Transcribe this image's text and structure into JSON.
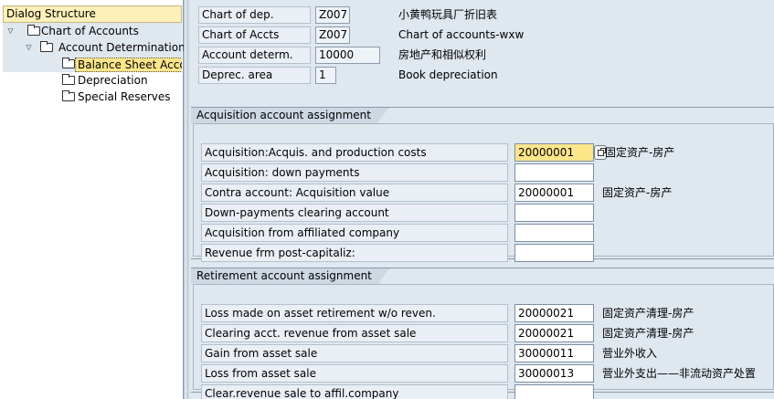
{
  "dialog_structure": {
    "title": "Dialog Structure",
    "nodes": [
      {
        "label": "Chart of Accounts",
        "level": 0,
        "expanded": true
      },
      {
        "label": "Account Determination",
        "level": 1,
        "expanded": true
      },
      {
        "label": "Balance Sheet Accou",
        "level": 2,
        "selected": true
      },
      {
        "label": "Depreciation",
        "level": 2
      },
      {
        "label": "Special Reserves",
        "level": 2
      }
    ]
  },
  "header_fields": [
    {
      "label": "Chart of dep.",
      "value": "Z007",
      "description": "小黄鸭玩具厂折旧表"
    },
    {
      "label": "Chart of Accts",
      "value": "Z007",
      "description": "Chart of accounts-wxw"
    },
    {
      "label": "Account determ.",
      "value": "10000",
      "description": "房地产和相似权利"
    },
    {
      "label": "Deprec. area",
      "value": "1",
      "description": "Book depreciation"
    }
  ],
  "acquisition_group": {
    "title": "Acquisition account assignment",
    "rows": [
      {
        "label": "Acquisition:Acquis. and production costs",
        "value": "20000001",
        "description": "固定资产-房产"
      },
      {
        "label": "Acquisition: down payments",
        "value": "",
        "description": ""
      },
      {
        "label": "Contra account: Acquisition value",
        "value": "20000001",
        "description": "固定资产-房产"
      },
      {
        "label": "Down-payments clearing account",
        "value": "",
        "description": ""
      },
      {
        "label": "Acquisition from affiliated company",
        "value": "",
        "description": ""
      },
      {
        "label": "Revenue frm post-capitaliz:",
        "value": "",
        "description": ""
      }
    ]
  },
  "retirement_group": {
    "title": "Retirement account assignment",
    "rows": [
      {
        "label": "Loss made on asset retirement w/o reven.",
        "value": "20000021",
        "description": "固定资产清理-房产"
      },
      {
        "label": "Clearing acct. revenue from asset sale",
        "value": "20000021",
        "description": "固定资产清理-房产"
      },
      {
        "label": "Gain from asset sale",
        "value": "30000011",
        "description": "营业外收入"
      },
      {
        "label": "Loss from asset sale",
        "value": "30000013",
        "description": "营业外支出——非流动资产处置"
      },
      {
        "label": "Clear.revenue sale to affil.company",
        "value": "",
        "description": ""
      }
    ]
  },
  "colors": {
    "background": "#dfe7ef",
    "focused_field": "#fde68a",
    "tree_header": "#fdf0b9"
  }
}
